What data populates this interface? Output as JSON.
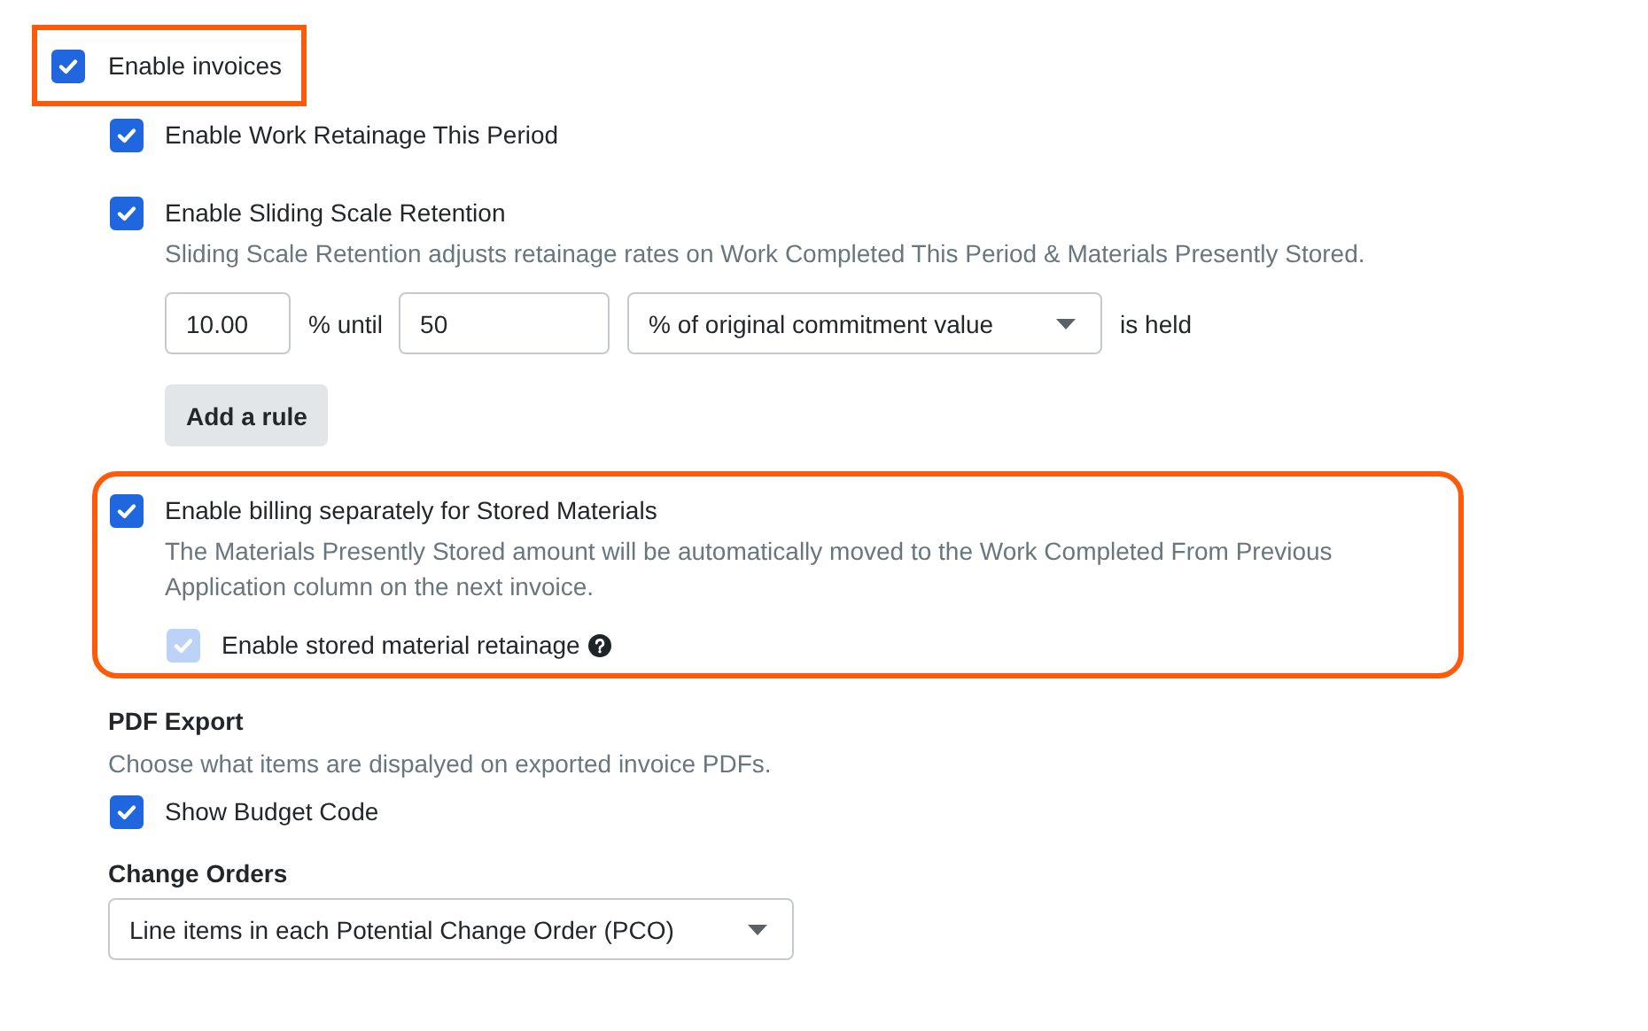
{
  "invoices": {
    "label": "Enable invoices",
    "checked": true,
    "highlighted": true
  },
  "options": [
    {
      "label": "Enable Work Retainage This Period",
      "checked": true,
      "highlighted": false
    },
    {
      "label": "Enable Sliding Scale Retention",
      "checked": true,
      "highlighted": false,
      "description": "Sliding Scale Retention adjusts retainage rates on Work Completed This Period & Materials Presently Stored.",
      "rule": {
        "percent": "10.00",
        "until_label": "% until",
        "threshold": "50",
        "basis": "% of original commitment value",
        "held_label": "is held",
        "add_button": "Add a rule"
      }
    },
    {
      "label": "Enable billing separately for Stored Materials",
      "checked": true,
      "highlighted": true,
      "description": "The Materials Presently Stored amount will be automatically moved to the Work Completed From Previous Application column on the next invoice.",
      "suboption": {
        "label": "Enable stored material retainage",
        "checked": true,
        "disabled": true,
        "help": true
      }
    }
  ],
  "pdf_export": {
    "heading": "PDF Export",
    "description": "Choose what items are dispalyed on exported invoice PDFs.",
    "options": [
      {
        "label": "Show Budget Code",
        "checked": true
      }
    ]
  },
  "change_orders": {
    "heading": "Change Orders",
    "value": "Line items in each Potential Change Order (PCO)"
  }
}
